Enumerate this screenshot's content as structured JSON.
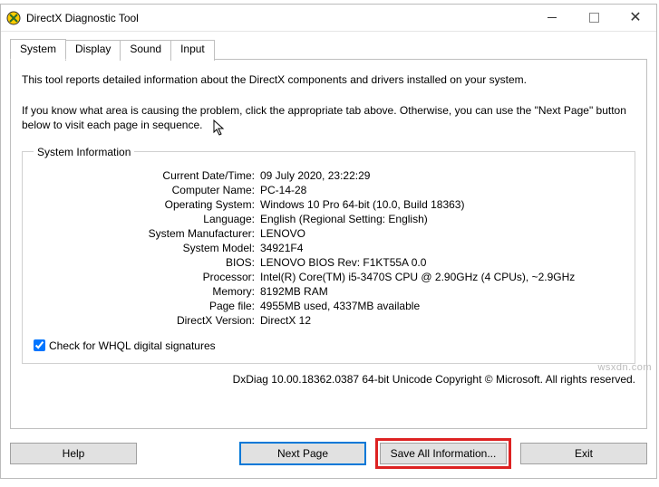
{
  "window": {
    "title": "DirectX Diagnostic Tool"
  },
  "tabs": {
    "system": "System",
    "display": "Display",
    "sound": "Sound",
    "input": "Input"
  },
  "intro": {
    "line1": "This tool reports detailed information about the DirectX components and drivers installed on your system.",
    "line2": "If you know what area is causing the problem, click the appropriate tab above.  Otherwise, you can use the \"Next Page\" button below to visit each page in sequence."
  },
  "sysinfo": {
    "legend": "System Information",
    "fields": {
      "date_label": "Current Date/Time:",
      "date_value": "09 July 2020, 23:22:29",
      "computer_label": "Computer Name:",
      "computer_value": "PC-14-28",
      "os_label": "Operating System:",
      "os_value": "Windows 10 Pro 64-bit (10.0, Build 18363)",
      "lang_label": "Language:",
      "lang_value": "English (Regional Setting: English)",
      "manu_label": "System Manufacturer:",
      "manu_value": "LENOVO",
      "model_label": "System Model:",
      "model_value": "34921F4",
      "bios_label": "BIOS:",
      "bios_value": "LENOVO BIOS Rev: F1KT55A 0.0",
      "cpu_label": "Processor:",
      "cpu_value": "Intel(R) Core(TM) i5-3470S CPU @ 2.90GHz (4 CPUs), ~2.9GHz",
      "mem_label": "Memory:",
      "mem_value": "8192MB RAM",
      "page_label": "Page file:",
      "page_value": "4955MB used, 4337MB available",
      "dx_label": "DirectX Version:",
      "dx_value": "DirectX 12"
    },
    "whql_label": "Check for WHQL digital signatures"
  },
  "footer": "DxDiag 10.00.18362.0387 64-bit Unicode   Copyright © Microsoft. All rights reserved.",
  "buttons": {
    "help": "Help",
    "next": "Next Page",
    "save": "Save All Information...",
    "exit": "Exit"
  },
  "watermark": "wsxdn.com"
}
